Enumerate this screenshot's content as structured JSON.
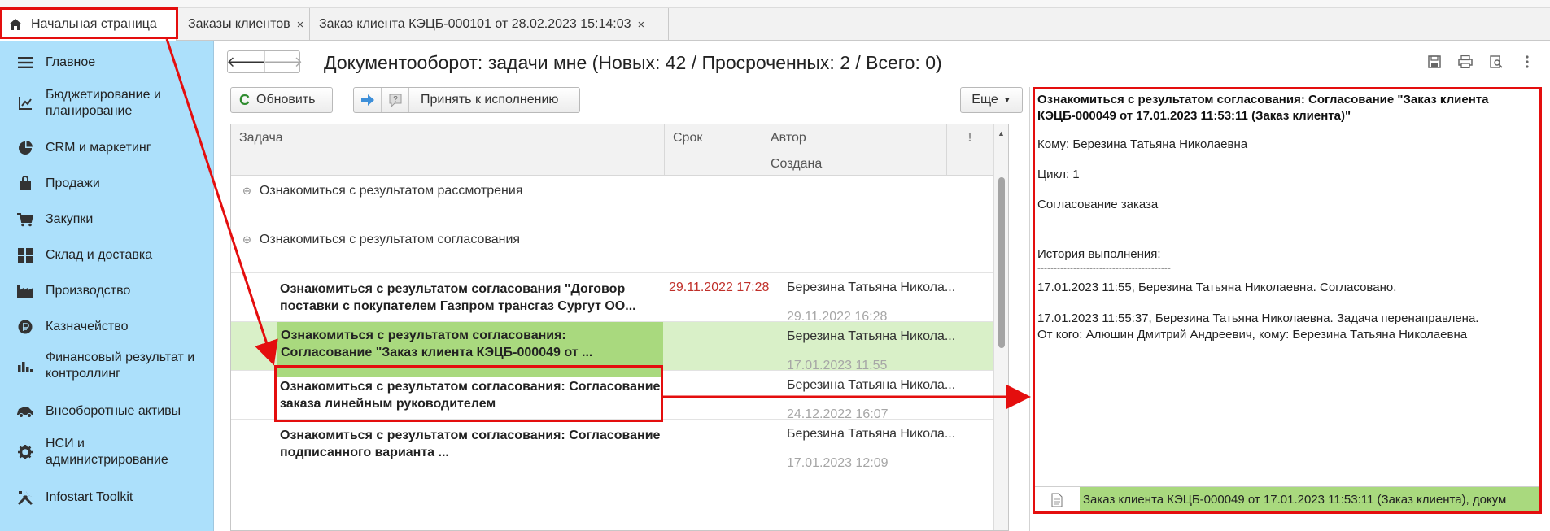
{
  "tabs": [
    {
      "label": "Начальная страница"
    },
    {
      "label": "Заказы клиентов",
      "close": "×"
    },
    {
      "label": "Заказ клиента КЭЦБ-000101 от 28.02.2023 15:14:03",
      "close": "×"
    }
  ],
  "sidebar": {
    "items": [
      {
        "label": "Главное",
        "icon": "menu-icon"
      },
      {
        "label": "Бюджетирование и планирование",
        "icon": "budget-icon"
      },
      {
        "label": "CRM и маркетинг",
        "icon": "pie-icon"
      },
      {
        "label": "Продажи",
        "icon": "bag-icon"
      },
      {
        "label": "Закупки",
        "icon": "cart-icon"
      },
      {
        "label": "Склад и доставка",
        "icon": "warehouse-icon"
      },
      {
        "label": "Производство",
        "icon": "factory-icon"
      },
      {
        "label": "Казначейство",
        "icon": "coin-icon"
      },
      {
        "label": "Финансовый результат и контроллинг",
        "icon": "chart-icon"
      },
      {
        "label": "Внеоборотные активы",
        "icon": "car-icon"
      },
      {
        "label": "НСИ и администрирование",
        "icon": "gear-icon"
      },
      {
        "label": "Infostart Toolkit",
        "icon": "tools-icon"
      }
    ]
  },
  "header": {
    "title": "Документооборот: задачи мне (Новых: 42 / Просроченных: 2 / Всего: 0)"
  },
  "toolbar": {
    "refresh_label": "Обновить",
    "accept_label": "Принять к исполнению",
    "more_label": "Еще"
  },
  "table": {
    "columns": {
      "task": "Задача",
      "deadline": "Срок",
      "author": "Автор",
      "created": "Создана",
      "flag": "!"
    },
    "groups": [
      {
        "label": "Ознакомиться с результатом рассмотрения"
      },
      {
        "label": "Ознакомиться с результатом согласования"
      }
    ],
    "rows": [
      {
        "task": "Ознакомиться с результатом согласования \"Договор поставки с покупателем Газпром трансгаз Сургут ОО...",
        "deadline": "29.11.2022 17:28",
        "author": "Березина Татьяна Никола...",
        "created": "29.11.2022 16:28"
      },
      {
        "task": "Ознакомиться с результатом согласования: Согласование \"Заказ клиента КЭЦБ-000049 от ...",
        "deadline": "",
        "author": "Березина Татьяна Никола...",
        "created": "17.01.2023 11:55"
      },
      {
        "task": "Ознакомиться с результатом согласования: Согласование заказа линейным руководителем",
        "deadline": "",
        "author": "Березина Татьяна Никола...",
        "created": "24.12.2022 16:07"
      },
      {
        "task": "Ознакомиться с результатом согласования: Согласование подписанного варианта ...",
        "deadline": "",
        "author": "Березина Татьяна Никола...",
        "created": "17.01.2023 12:09"
      }
    ]
  },
  "preview": {
    "title": "Ознакомиться с результатом согласования: Согласование \"Заказ клиента КЭЦБ-000049 от 17.01.2023 11:53:11 (Заказ клиента)\"",
    "to": "Кому: Березина Татьяна Николаевна",
    "cycle": "Цикл: 1",
    "subject": "Согласование заказа",
    "history_label": "История выполнения:",
    "divider": "-----------------------------------------",
    "history_1": "17.01.2023 11:55, Березина Татьяна Николаевна. Согласовано.",
    "history_2": "17.01.2023 11:55:37, Березина Татьяна Николаевна. Задача перенаправлена.",
    "history_3": "От кого: Алюшин Дмитрий Андреевич, кому: Березина Татьяна Николаевна",
    "attachment": "Заказ клиента КЭЦБ-000049 от 17.01.2023 11:53:11 (Заказ клиента), докум"
  },
  "colors": {
    "sidebar_bg": "#ace0fb",
    "selected_row": "#d9f0c8",
    "selected_cell": "#a9d97e",
    "overdue_date": "#c0302a",
    "annotation_red": "#e40e0e"
  }
}
